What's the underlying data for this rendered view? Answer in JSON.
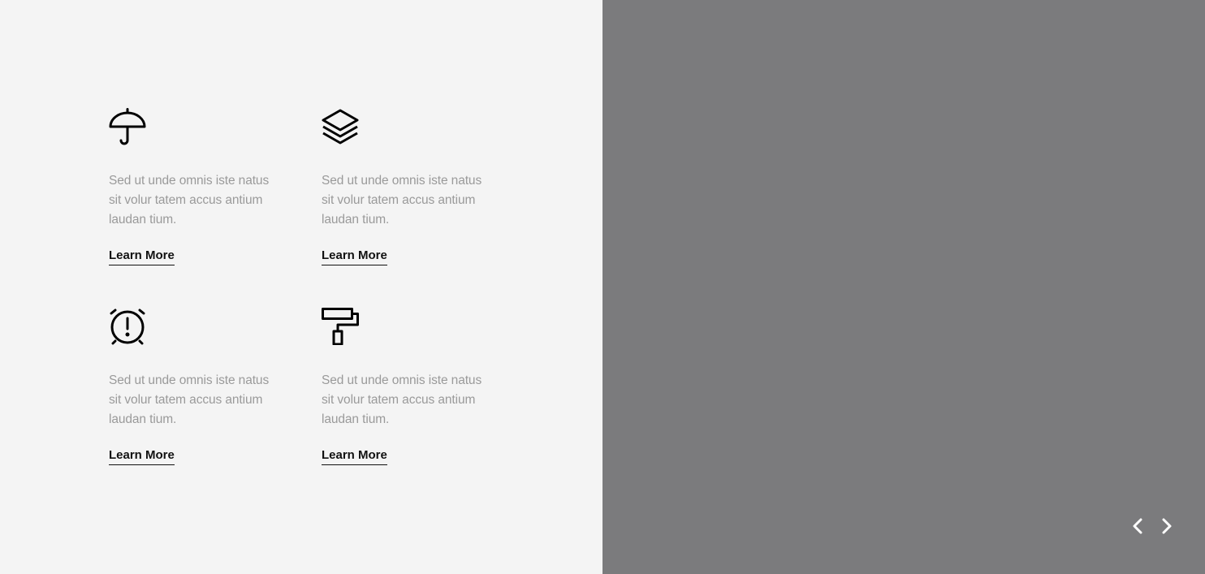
{
  "features": [
    {
      "icon": "umbrella-icon",
      "text": "Sed ut unde omnis iste natus sit volur tatem accus antium laudan tium.",
      "link_label": "Learn More"
    },
    {
      "icon": "layers-icon",
      "text": "Sed ut unde omnis iste natus sit volur tatem accus antium laudan tium.",
      "link_label": "Learn More"
    },
    {
      "icon": "alarm-clock-icon",
      "text": "Sed ut unde omnis iste natus sit volur tatem accus antium laudan tium.",
      "link_label": "Learn More"
    },
    {
      "icon": "paint-roller-icon",
      "text": "Sed ut unde omnis iste natus sit volur tatem accus antium laudan tium.",
      "link_label": "Learn More"
    }
  ],
  "slider": {
    "prev_icon": "chevron-left-icon",
    "next_icon": "chevron-right-icon"
  },
  "colors": {
    "left_background": "#f4f4f4",
    "right_background": "#7b7b7d",
    "text_muted": "#9a9a9a",
    "text_dark": "#111111"
  }
}
